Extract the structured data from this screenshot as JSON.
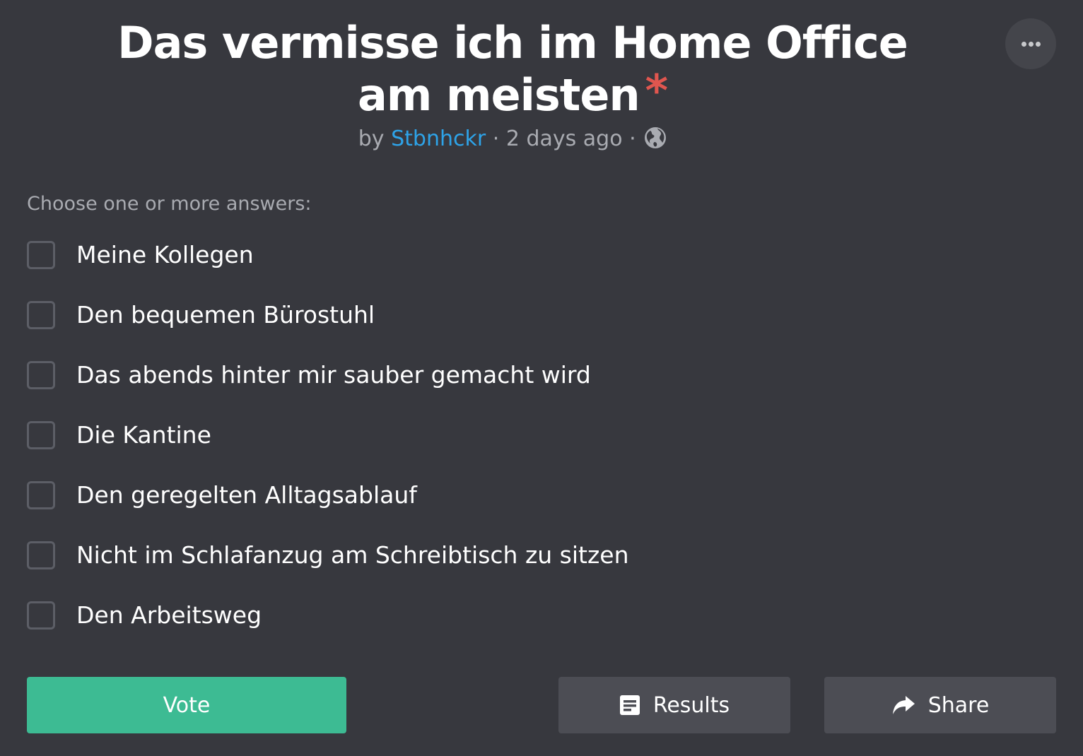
{
  "poll": {
    "title": "Das vermisse ich im Home Office am meisten",
    "required_marker": "*",
    "meta": {
      "by_label": "by",
      "author": "Stbnhckr",
      "separator": "·",
      "time_ago": "2 days ago",
      "visibility_icon": "globe-icon"
    },
    "instruction": "Choose one or more answers:",
    "options": [
      {
        "label": "Meine Kollegen",
        "checked": false
      },
      {
        "label": "Den bequemen Bürostuhl",
        "checked": false
      },
      {
        "label": "Das abends hinter mir sauber gemacht wird",
        "checked": false
      },
      {
        "label": "Die Kantine",
        "checked": false
      },
      {
        "label": "Den geregelten Alltagsablauf",
        "checked": false
      },
      {
        "label": "Nicht im Schlafanzug am Schreibtisch zu sitzen",
        "checked": false
      },
      {
        "label": "Den Arbeitsweg",
        "checked": false
      }
    ]
  },
  "actions": {
    "vote_label": "Vote",
    "results_label": "Results",
    "results_icon": "results-icon",
    "share_label": "Share",
    "share_icon": "share-icon",
    "more_icon": "more-icon"
  },
  "colors": {
    "background": "#37383e",
    "accent_vote": "#3dbb93",
    "author_link": "#2ea3e8",
    "required": "#e0564f",
    "secondary_button": "#4c4d54"
  }
}
